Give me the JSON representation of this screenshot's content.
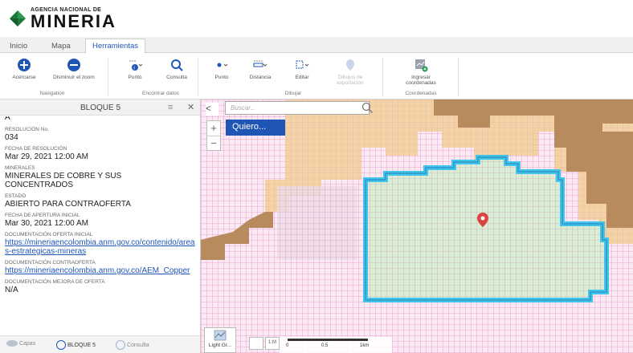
{
  "header": {
    "logo_small": "AGENCIA NACIONAL DE",
    "logo_big": "MINERIA"
  },
  "tabs": [
    {
      "label": "Inicio"
    },
    {
      "label": "Mapa"
    },
    {
      "label": "Herramientas"
    }
  ],
  "ribbon": {
    "acercarse": "Acercarse",
    "disminuir": "Disminuir el zoom",
    "punto1": "Punto",
    "consulta": "Consulta",
    "punto2": "Punto",
    "distancia": "Distancia",
    "editar": "Editar",
    "dibujos": "Dibujos de exportación",
    "ingresar": "Ingresar coordenadas",
    "grp_navigation": "Navigation",
    "grp_encontrar": "Encontrar datos",
    "grp_dibujar": "Dibujar",
    "grp_coordenadas": "Coordenadas"
  },
  "panel": {
    "title": "BLOQUE 5",
    "first_value": "A",
    "fields": [
      {
        "label": "RESOLUCIÓN No.",
        "value": "034"
      },
      {
        "label": "FECHA DE RESOLUCIÓN",
        "value": "Mar 29, 2021 12:00 AM"
      },
      {
        "label": "MINERALES",
        "value": "MINERALES DE COBRE Y SUS CONCENTRADOS"
      },
      {
        "label": "ESTADO",
        "value": "ABIERTO PARA CONTRAOFERTA"
      },
      {
        "label": "FECHA DE APERTURA INICIAL",
        "value": "Mar 30, 2021 12:00 AM"
      },
      {
        "label": "DOCUMENTACIÓN OFERTA INICIAL",
        "value": "https://mineriaencolombia.anm.gov.co/contenido/areas-estrategicas-mineras"
      },
      {
        "label": "DOCUMENTACIÓN CONTRAOFERTA",
        "value": "https://mineriaencolombia.anm.gov.co/AEM_Copper"
      },
      {
        "label": "DOCUMENTACIÓN MEJORA DE OFERTA",
        "value": "N/A"
      }
    ],
    "footer": {
      "capas": "Capas",
      "bloque": "BLOQUE 5",
      "consulta": "Consulta"
    }
  },
  "map": {
    "search_placeholder": "Buscar...",
    "quiero": "Quiero...",
    "basemap_label": "Light Gr...",
    "scale_labels": [
      "0",
      "0.5",
      "1km"
    ],
    "colors": {
      "pink_grid": "#e88fc4",
      "tan": "#f3d3a6",
      "brown": "#b88b5e",
      "selection_fill": "#d8efd4",
      "selection_border": "#37c4ee",
      "marker": "#d64541"
    }
  }
}
